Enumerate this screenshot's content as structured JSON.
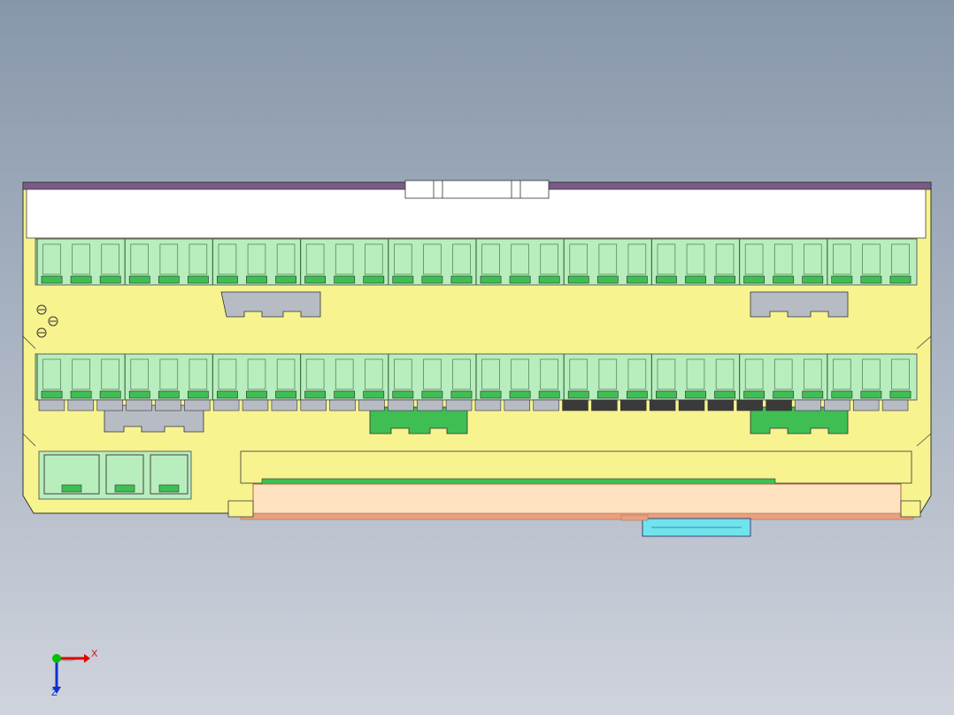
{
  "viewport": {
    "background_top": "#8797aa",
    "background_bottom": "#cfd3dc"
  },
  "model": {
    "housing_color": "#f7f38f",
    "top_rail_color": "#7b5a86",
    "terminal_color": "#b8eebd",
    "terminal_dark_color": "#3fbf53",
    "contact_gray_color": "#b7bcc4",
    "contact_dark_color": "#3a3a3a",
    "base_peach_color": "#ffe3c0",
    "base_edge_color": "#e8a080",
    "connector_color": "#6fe4ec",
    "terminals_per_row": 30
  },
  "triad": {
    "x_label": "X",
    "z_label": "Z",
    "x_color": "#e00000",
    "y_color": "#00c000",
    "z_color": "#1030d0"
  }
}
